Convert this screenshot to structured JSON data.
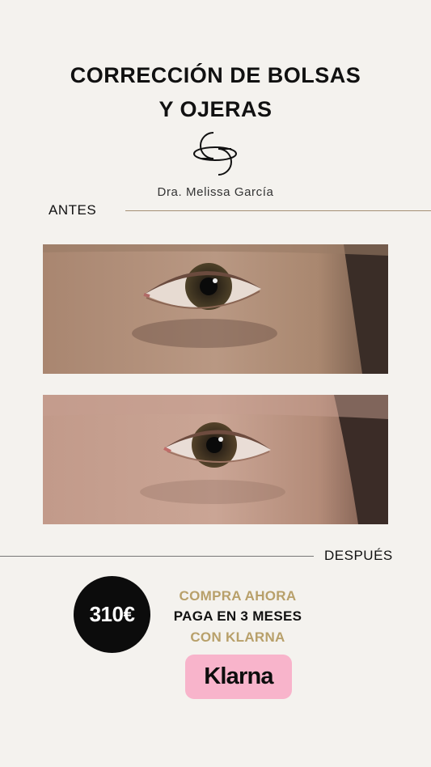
{
  "title": {
    "line1": "CORRECCIÓN DE BOLSAS",
    "line2": "Y OJERAS"
  },
  "doctor": "Dra. Melissa García",
  "labels": {
    "before": "ANTES",
    "after": "DESPUÉS"
  },
  "price": "310€",
  "promo": {
    "line1": "COMPRA AHORA",
    "line2": "PAGA EN 3 MESES",
    "line3": "CON KLARNA"
  },
  "klarna_button": "Klarna",
  "colors": {
    "background": "#f4f2ee",
    "gold": "#b8a06a",
    "klarna_pink": "#f8b4cb",
    "badge": "#0c0c0c"
  }
}
